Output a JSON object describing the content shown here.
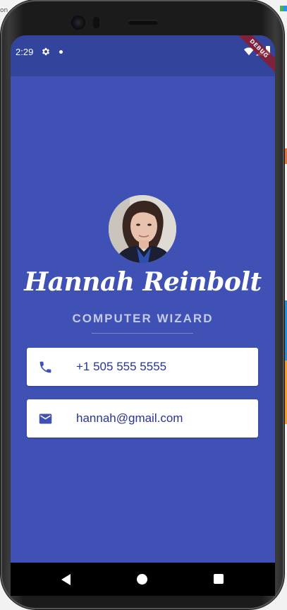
{
  "background": {
    "left_text": "on"
  },
  "status_bar": {
    "time": "2:29",
    "debug_label": "DEBUG"
  },
  "profile": {
    "name": "Hannah Reinbolt",
    "title": "COMPUTER WIZARD"
  },
  "contacts": {
    "phone": "+1 505 555 5555",
    "email": "hannah@gmail.com"
  },
  "icons": {
    "status": [
      "gear-icon",
      "notification-dot-icon",
      "wifi-icon",
      "signal-icon",
      "battery-icon"
    ],
    "cards": [
      "phone-icon",
      "email-icon"
    ],
    "nav": [
      "back-icon",
      "home-icon",
      "recents-icon"
    ]
  },
  "colors": {
    "app_background": "#3f51b5",
    "status_bar": "#33449d",
    "card_text": "#283593",
    "title_text": "#c5cae9",
    "debug_banner": "#8e1c2b"
  }
}
